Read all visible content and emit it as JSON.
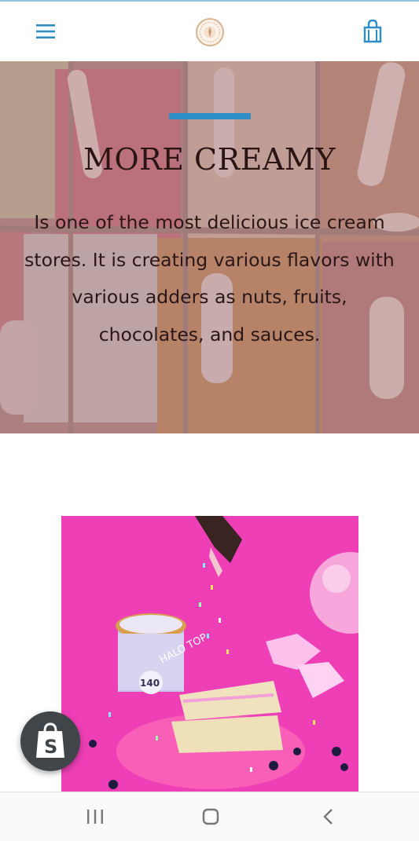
{
  "header": {
    "menu_icon": "hamburger-menu-icon",
    "logo_icon": "store-logo-emblem",
    "cart_icon": "shopping-bag-icon"
  },
  "hero": {
    "title": "MORE CREAMY",
    "description": "Is one of the most delicious ice cream stores. It is creating various flavors with various adders as nuts, fruits, chocolates, and sauces."
  },
  "product_image": {
    "pint_label_brand": "HALO TOP",
    "pint_label_calories": "140"
  },
  "shopify_badge": {
    "icon": "shopify-bag-icon"
  },
  "system_nav": {
    "recents_icon": "recents-icon",
    "home_icon": "home-icon",
    "back_icon": "back-icon"
  },
  "colors": {
    "accent": "#2c8ec4",
    "hero_tint": "#b58a89",
    "badge_bg": "#3f4549",
    "product_bg": "#ee3fb6"
  }
}
